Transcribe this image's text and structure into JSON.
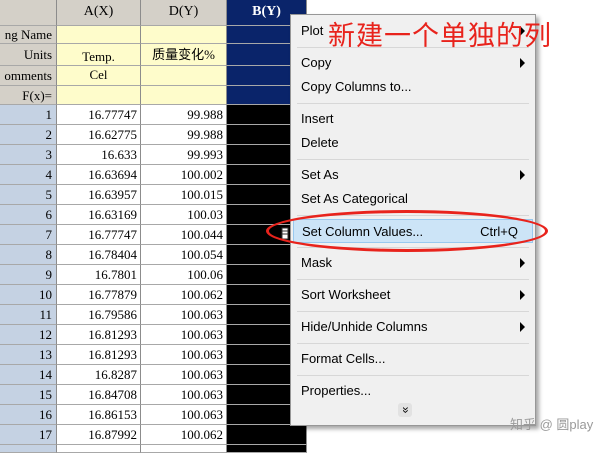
{
  "columns": {
    "a_header": "A(X)",
    "d_header": "D(Y)",
    "b_header": "B(Y)"
  },
  "meta_rows": {
    "long_name_label": "ng Name",
    "units_label": "Units",
    "comments_label": "omments",
    "fx_label": "F(x)=",
    "a_units": "Temp.",
    "a_comments": "Cel",
    "d_units": "质量变化%"
  },
  "rows": [
    {
      "n": "1",
      "a": "16.77747",
      "d": "99.988"
    },
    {
      "n": "2",
      "a": "16.62775",
      "d": "99.988"
    },
    {
      "n": "3",
      "a": "16.633",
      "d": "99.993"
    },
    {
      "n": "4",
      "a": "16.63694",
      "d": "100.002"
    },
    {
      "n": "5",
      "a": "16.63957",
      "d": "100.015"
    },
    {
      "n": "6",
      "a": "16.63169",
      "d": "100.03"
    },
    {
      "n": "7",
      "a": "16.77747",
      "d": "100.044"
    },
    {
      "n": "8",
      "a": "16.78404",
      "d": "100.054"
    },
    {
      "n": "9",
      "a": "16.7801",
      "d": "100.06"
    },
    {
      "n": "10",
      "a": "16.77879",
      "d": "100.062"
    },
    {
      "n": "11",
      "a": "16.79586",
      "d": "100.063"
    },
    {
      "n": "12",
      "a": "16.81293",
      "d": "100.063"
    },
    {
      "n": "13",
      "a": "16.81293",
      "d": "100.063"
    },
    {
      "n": "14",
      "a": "16.8287",
      "d": "100.063"
    },
    {
      "n": "15",
      "a": "16.84708",
      "d": "100.063"
    },
    {
      "n": "16",
      "a": "16.86153",
      "d": "100.063"
    },
    {
      "n": "17",
      "a": "16.87992",
      "d": "100.062"
    }
  ],
  "menu": {
    "plot": "Plot",
    "copy": "Copy",
    "copy_columns_to": "Copy Columns to...",
    "insert": "Insert",
    "delete": "Delete",
    "set_as": "Set As",
    "set_as_categorical": "Set As Categorical",
    "set_column_values": "Set Column Values...",
    "set_column_values_shortcut": "Ctrl+Q",
    "mask": "Mask",
    "sort_worksheet": "Sort Worksheet",
    "hide_unhide_columns": "Hide/Unhide Columns",
    "format_cells": "Format Cells...",
    "properties": "Properties...",
    "more_glyph": "»"
  },
  "annotation": "新建一个单独的列",
  "watermark": "知乎 @ 圆play",
  "colors": {
    "annotation_red": "#e8231c",
    "meta_yellow": "#fefccb",
    "rownum_blue": "#c5d2e3",
    "selected_header": "#0a246a"
  }
}
